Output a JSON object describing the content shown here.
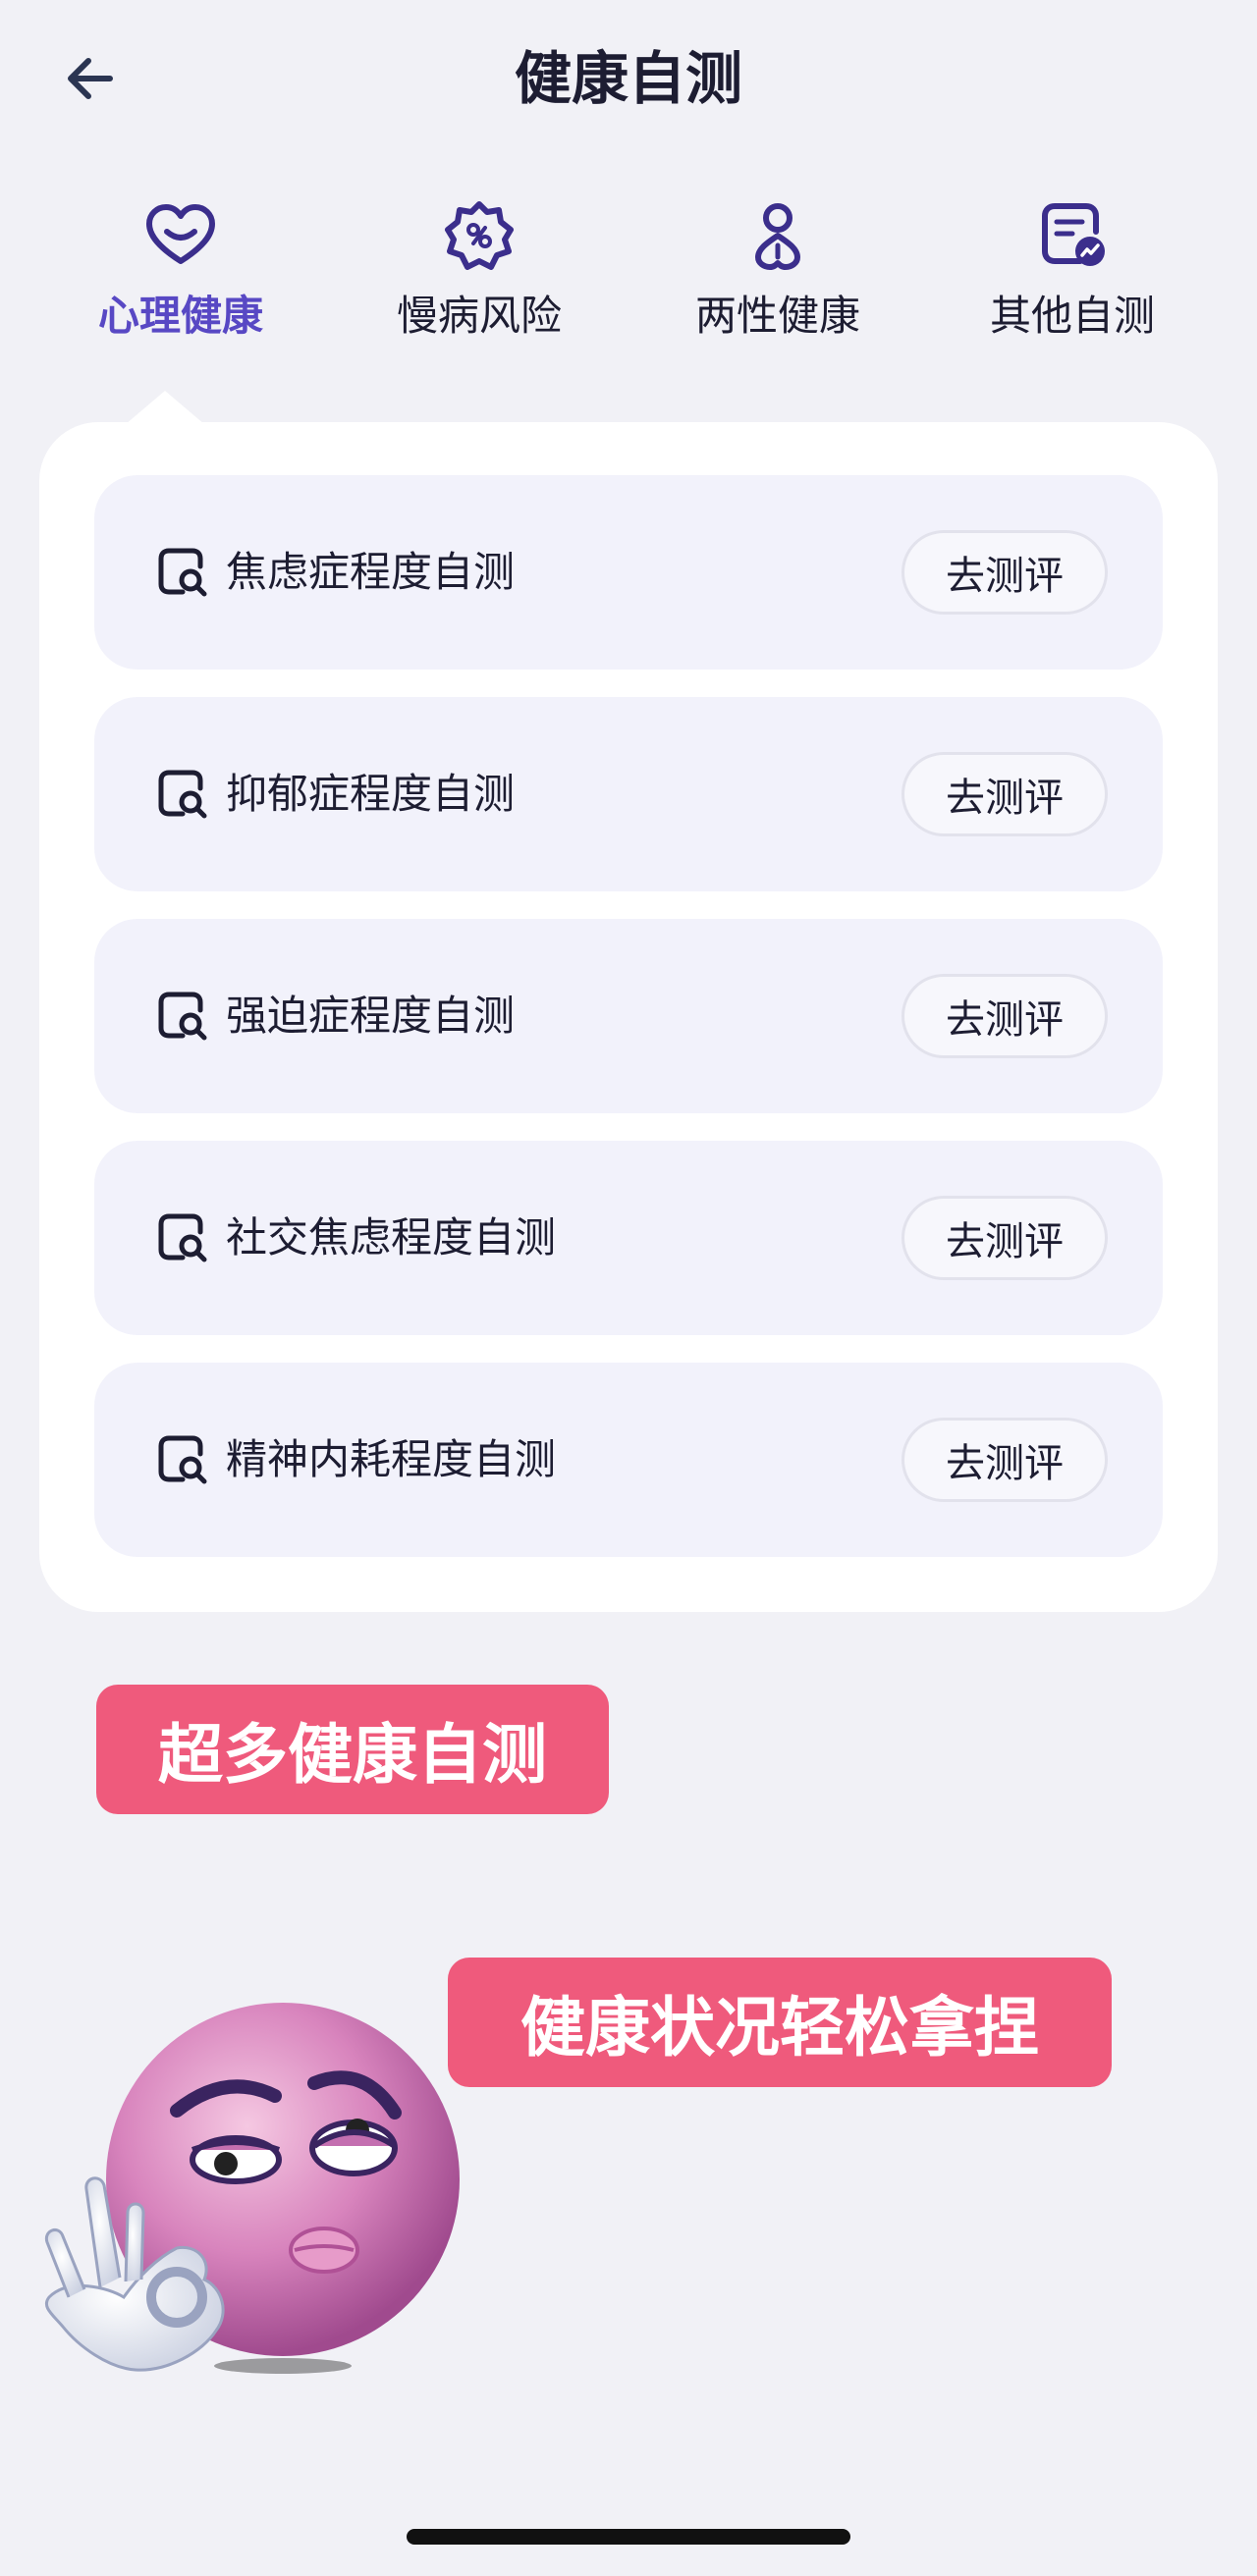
{
  "header": {
    "title": "健康自测",
    "back_icon": "arrow-left-icon"
  },
  "tabs": [
    {
      "label": "心理健康",
      "icon": "heart-icon",
      "active": true
    },
    {
      "label": "慢病风险",
      "icon": "virus-icon",
      "active": false
    },
    {
      "label": "两性健康",
      "icon": "gender-icon",
      "active": false
    },
    {
      "label": "其他自测",
      "icon": "document-chart-icon",
      "active": false
    }
  ],
  "tests": [
    {
      "name": "焦虑症程度自测",
      "button": "去测评",
      "icon": "document-search-icon"
    },
    {
      "name": "抑郁症程度自测",
      "button": "去测评",
      "icon": "document-search-icon"
    },
    {
      "name": "强迫症程度自测",
      "button": "去测评",
      "icon": "document-search-icon"
    },
    {
      "name": "社交焦虑程度自测",
      "button": "去测评",
      "icon": "document-search-icon"
    },
    {
      "name": "精神内耗程度自测",
      "button": "去测评",
      "icon": "document-search-icon"
    }
  ],
  "promo": {
    "tag1": "超多健康自测",
    "tag2": "健康状况轻松拿捏"
  },
  "colors": {
    "background": "#f1f1f6",
    "accent": "#5848c4",
    "icon_purple": "#3b2e8c",
    "tag_pink": "#ef5a7c",
    "row_background": "#f2f2fb"
  }
}
